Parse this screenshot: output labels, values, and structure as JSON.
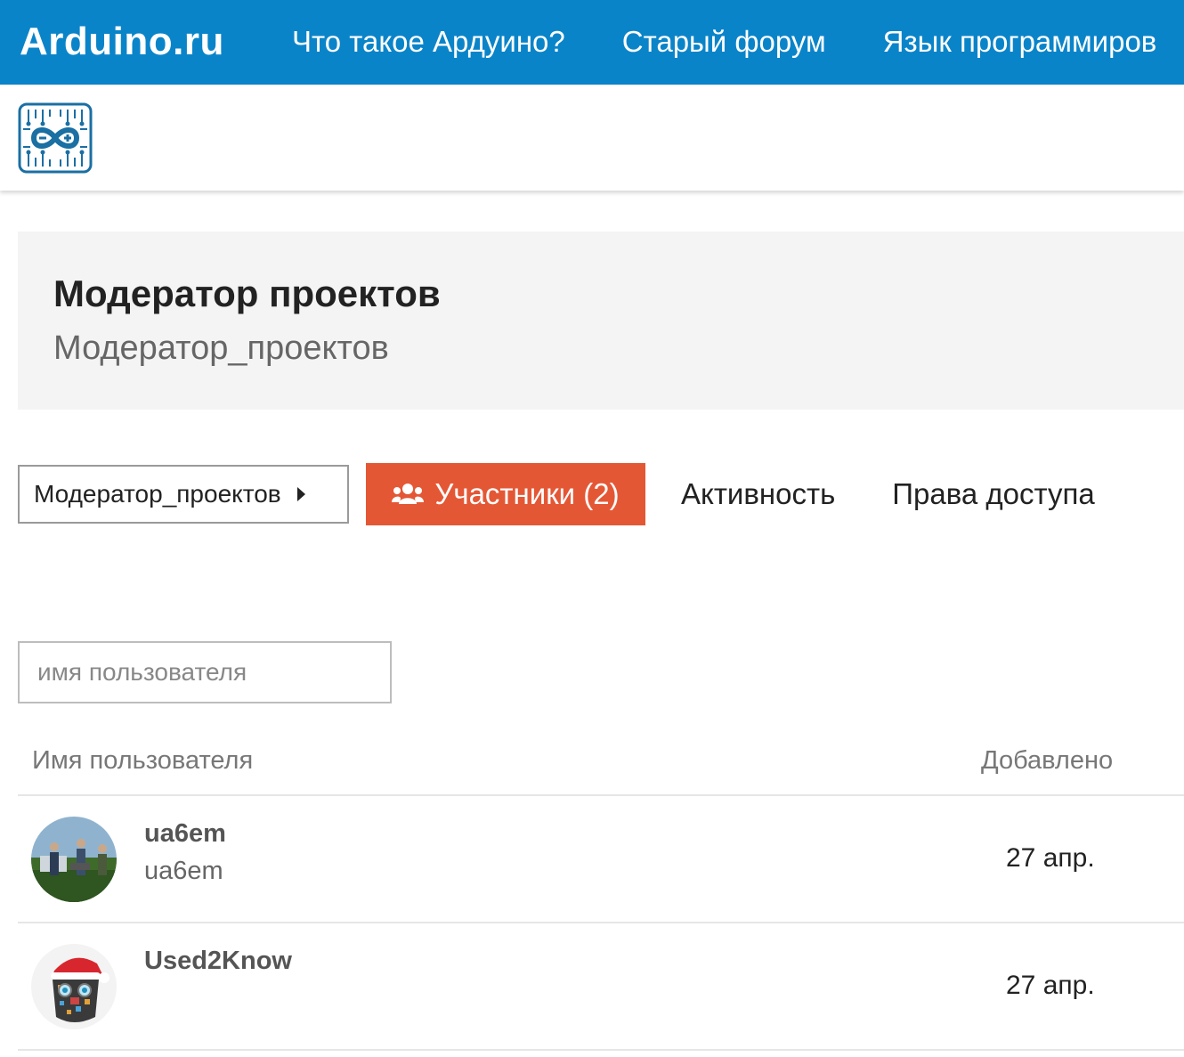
{
  "header": {
    "brand": "Arduino.ru",
    "nav": [
      "Что такое Ардуино?",
      "Старый форум",
      "Язык программиров"
    ]
  },
  "logo": {
    "icon": "arduino-logo-icon",
    "color": "#1a6fa3"
  },
  "group": {
    "title": "Модератор проектов",
    "name": "Модератор_проектов"
  },
  "controls": {
    "group_select": "Модератор_проектов",
    "members_button": "Участники (2)",
    "activity_tab": "Активность",
    "permissions_tab": "Права доступа"
  },
  "search": {
    "placeholder": "имя пользователя",
    "value": ""
  },
  "table": {
    "columns": [
      "Имя пользователя",
      "Добавлено"
    ],
    "rows": [
      {
        "username": "ua6em",
        "name": "ua6em",
        "added": "27 апр."
      },
      {
        "username": "Used2Know",
        "name": "",
        "added": "27 апр."
      }
    ]
  },
  "colors": {
    "header_bg": "#0a84c9",
    "accent": "#e45735",
    "banner_bg": "#f4f4f4"
  }
}
